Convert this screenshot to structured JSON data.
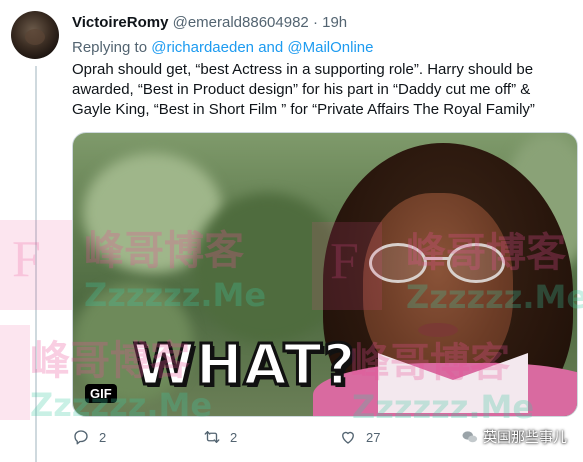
{
  "tweet": {
    "display_name": "VictoireRomy",
    "handle": "@emerald88604982",
    "separator": "·",
    "time": "19h",
    "replying_to_prefix": "Replying to",
    "reply_handle_1": "@richardaeden",
    "reply_and": "and",
    "reply_handle_2": "@MailOnline",
    "text": "Oprah should get, “best Actress in a supporting role”. Harry should be awarded, “Best in Product design” for his part in “Daddy cut me off” & Gayle King, “Best in Short Film ” for “Private Affairs The Royal Family”"
  },
  "media": {
    "caption": "WHAT?",
    "badge": "GIF"
  },
  "watermark": {
    "cn": "峰哥博客",
    "en": "Zzzzzz.Me",
    "letter": "F"
  },
  "actions": {
    "reply_count": "2",
    "retweet_count": "2",
    "like_count": "27"
  },
  "source": {
    "label": "英国那些事儿"
  },
  "icons": [
    "reply-icon",
    "retweet-icon",
    "like-icon",
    "wechat-icon"
  ],
  "colors": {
    "link": "#1d9bf0",
    "secondary_text": "#536471",
    "primary_text": "#0f1419",
    "thread_line": "#cfd9de"
  }
}
